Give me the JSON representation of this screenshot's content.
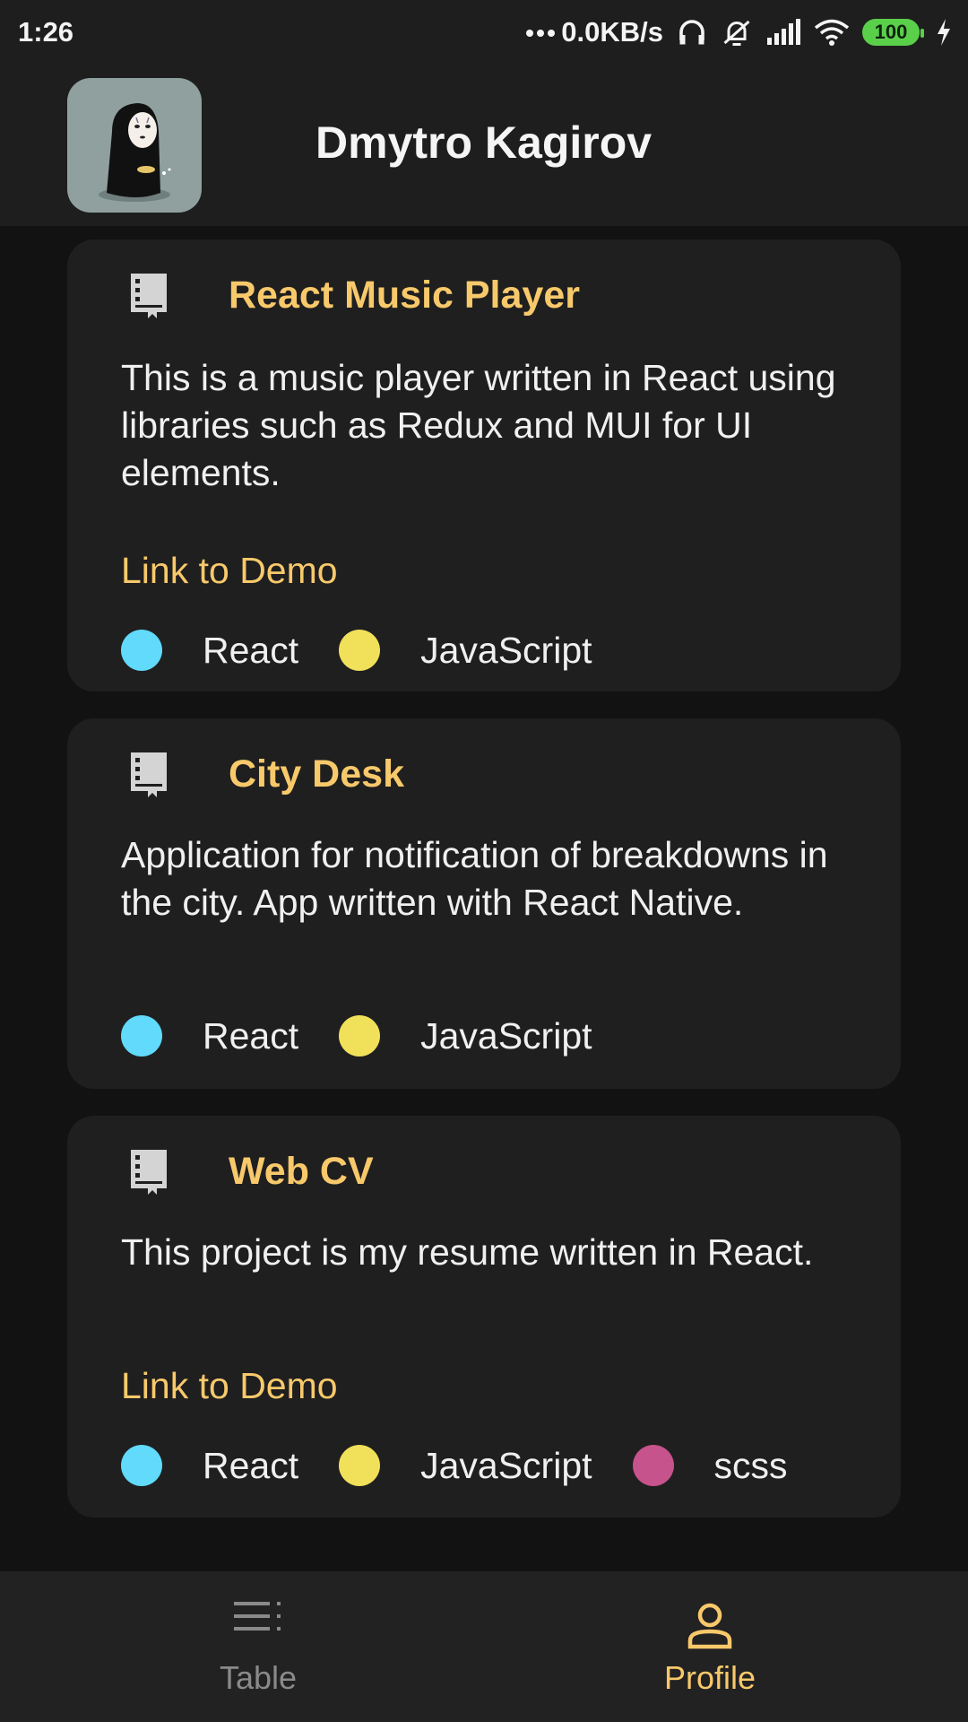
{
  "status_bar": {
    "time": "1:26",
    "network_speed": "0.0KB/s",
    "battery": "100",
    "icons": [
      "more-dots-icon",
      "headphones-icon",
      "alarm-muted-icon",
      "signal-icon",
      "wifi-icon",
      "battery-icon",
      "charging-icon"
    ]
  },
  "header": {
    "name": "Dmytro Kagirov"
  },
  "projects": [
    {
      "title": "React Music Player",
      "description": "This is a music player written in React using libraries such as Redux and MUI for UI elements.",
      "link_label": "Link to Demo",
      "languages": [
        {
          "name": "React",
          "color": "#61dafb"
        },
        {
          "name": "JavaScript",
          "color": "#f1e05a"
        }
      ]
    },
    {
      "title": "City Desk",
      "description": "Application for notification of breakdowns in the city. App written with React Native.",
      "languages": [
        {
          "name": "React",
          "color": "#61dafb"
        },
        {
          "name": "JavaScript",
          "color": "#f1e05a"
        }
      ]
    },
    {
      "title": "Web CV",
      "description": "This project is my resume written in React.",
      "link_label": "Link to Demo",
      "languages": [
        {
          "name": "React",
          "color": "#61dafb"
        },
        {
          "name": "JavaScript",
          "color": "#f1e05a"
        },
        {
          "name": "scss",
          "color": "#c6538c"
        }
      ]
    }
  ],
  "bottom_nav": {
    "items": [
      {
        "label": "Table",
        "icon": "list-icon",
        "active": false
      },
      {
        "label": "Profile",
        "icon": "person-icon",
        "active": true
      }
    ]
  },
  "colors": {
    "accent": "#f8c96b",
    "background": "#121212",
    "surface": "#1f1f1f",
    "battery": "#5ad04a"
  }
}
